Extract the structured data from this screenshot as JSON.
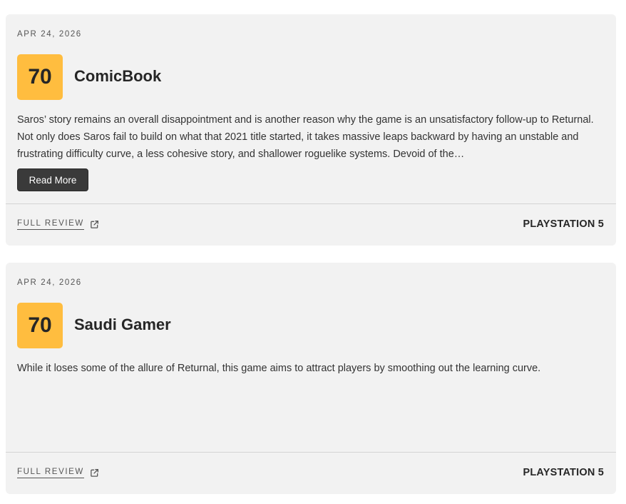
{
  "reviews": [
    {
      "date": "APR 24, 2026",
      "score": "70",
      "score_color": "#ffbd3f",
      "publication": "ComicBook",
      "quote": "Saros’ story remains an overall disappointment and is another reason why the game is an unsatisfactory follow-up to Returnal. Not only does Saros fail to build on what that 2021 title started, it takes massive leaps backward by having an unstable and frustrating difficulty curve, a less cohesive story, and shallower roguelike systems. Devoid of the…",
      "read_more_label": "Read More",
      "full_review_label": "FULL REVIEW",
      "full_review_icon": "external-link-icon",
      "platform": "PLAYSTATION 5"
    },
    {
      "date": "APR 24, 2026",
      "score": "70",
      "score_color": "#ffbd3f",
      "publication": "Saudi Gamer",
      "quote": "While it loses some of the allure of Returnal, this game aims to attract players by smoothing out the learning curve.",
      "full_review_label": "FULL REVIEW",
      "full_review_icon": "external-link-icon",
      "platform": "PLAYSTATION 5"
    }
  ]
}
